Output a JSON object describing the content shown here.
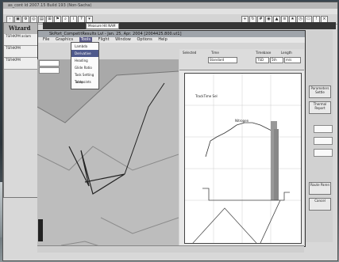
{
  "outer_window": {
    "title": "as_cont ld 2007.15 Build 193 (Non-Sacha)"
  },
  "wizard": {
    "title": "Wizard",
    "rows": [
      "TSFHKPM aslam",
      "TSFHKPM",
      "TSFHKPM"
    ]
  },
  "toolbar_field": "Measure Hit NAM",
  "inner_window": {
    "title": "SkPort_CompetitResults Lvl - Jan. 25, Apr. 2004 [2004425.800.ut1]",
    "menu": [
      "File",
      "Graphics",
      "Tools",
      "Flight",
      "Window",
      "Options",
      "Help"
    ],
    "active_menu": "Tools"
  },
  "dropdown": {
    "items": [
      "Lambda",
      "Derivative",
      "Heading",
      "Glide Ratio",
      "Task Setting Table",
      "Turnpoints"
    ],
    "selected_index": 1
  },
  "map_fields": [
    "",
    ""
  ],
  "right_pane": {
    "labels": {
      "selected": "Selected",
      "time": "Time",
      "standard": "Standard",
      "timebase": "Timebase",
      "tsd": "TSD",
      "length": "Length",
      "tz": "(DTH)",
      "width": "5th",
      "units": "m/s"
    }
  },
  "chart_labels": {
    "series_label": "TrackTime Sel",
    "mid_label": "Nitrogen"
  },
  "right_buttons": [
    "Parameters Settle",
    "Thermal Report",
    "Route Paren",
    "Cancel"
  ],
  "colors": {
    "map_background": "#bdbdbd",
    "chart_background": "#ffffff",
    "accent_menu": "#4f5a8c"
  }
}
